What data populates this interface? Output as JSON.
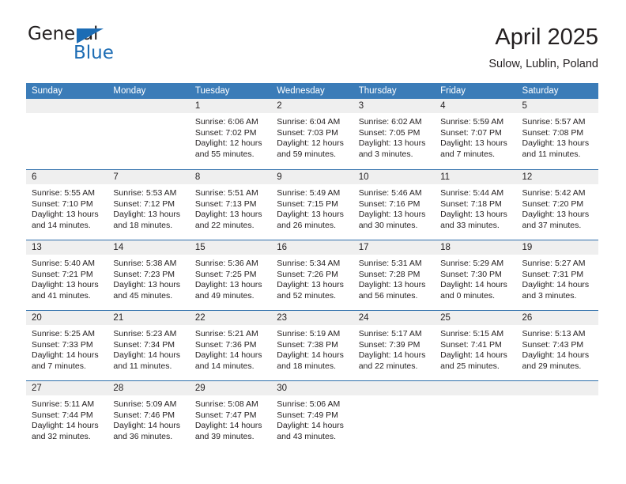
{
  "brand": {
    "name_part1": "General",
    "name_part2": "Blue",
    "colors": {
      "accent_blue": "#1c6cb4",
      "header_blue": "#3b7cb8",
      "row_rule_blue": "#2f6fab",
      "band_gray": "#efefef"
    }
  },
  "header": {
    "title": "April 2025",
    "subtitle": "Sulow, Lublin, Poland"
  },
  "weekdays": [
    "Sunday",
    "Monday",
    "Tuesday",
    "Wednesday",
    "Thursday",
    "Friday",
    "Saturday"
  ],
  "weeks": [
    [
      {
        "day": ""
      },
      {
        "day": ""
      },
      {
        "day": "1",
        "sunrise": "Sunrise: 6:06 AM",
        "sunset": "Sunset: 7:02 PM",
        "daylight": "Daylight: 12 hours and 55 minutes."
      },
      {
        "day": "2",
        "sunrise": "Sunrise: 6:04 AM",
        "sunset": "Sunset: 7:03 PM",
        "daylight": "Daylight: 12 hours and 59 minutes."
      },
      {
        "day": "3",
        "sunrise": "Sunrise: 6:02 AM",
        "sunset": "Sunset: 7:05 PM",
        "daylight": "Daylight: 13 hours and 3 minutes."
      },
      {
        "day": "4",
        "sunrise": "Sunrise: 5:59 AM",
        "sunset": "Sunset: 7:07 PM",
        "daylight": "Daylight: 13 hours and 7 minutes."
      },
      {
        "day": "5",
        "sunrise": "Sunrise: 5:57 AM",
        "sunset": "Sunset: 7:08 PM",
        "daylight": "Daylight: 13 hours and 11 minutes."
      }
    ],
    [
      {
        "day": "6",
        "sunrise": "Sunrise: 5:55 AM",
        "sunset": "Sunset: 7:10 PM",
        "daylight": "Daylight: 13 hours and 14 minutes."
      },
      {
        "day": "7",
        "sunrise": "Sunrise: 5:53 AM",
        "sunset": "Sunset: 7:12 PM",
        "daylight": "Daylight: 13 hours and 18 minutes."
      },
      {
        "day": "8",
        "sunrise": "Sunrise: 5:51 AM",
        "sunset": "Sunset: 7:13 PM",
        "daylight": "Daylight: 13 hours and 22 minutes."
      },
      {
        "day": "9",
        "sunrise": "Sunrise: 5:49 AM",
        "sunset": "Sunset: 7:15 PM",
        "daylight": "Daylight: 13 hours and 26 minutes."
      },
      {
        "day": "10",
        "sunrise": "Sunrise: 5:46 AM",
        "sunset": "Sunset: 7:16 PM",
        "daylight": "Daylight: 13 hours and 30 minutes."
      },
      {
        "day": "11",
        "sunrise": "Sunrise: 5:44 AM",
        "sunset": "Sunset: 7:18 PM",
        "daylight": "Daylight: 13 hours and 33 minutes."
      },
      {
        "day": "12",
        "sunrise": "Sunrise: 5:42 AM",
        "sunset": "Sunset: 7:20 PM",
        "daylight": "Daylight: 13 hours and 37 minutes."
      }
    ],
    [
      {
        "day": "13",
        "sunrise": "Sunrise: 5:40 AM",
        "sunset": "Sunset: 7:21 PM",
        "daylight": "Daylight: 13 hours and 41 minutes."
      },
      {
        "day": "14",
        "sunrise": "Sunrise: 5:38 AM",
        "sunset": "Sunset: 7:23 PM",
        "daylight": "Daylight: 13 hours and 45 minutes."
      },
      {
        "day": "15",
        "sunrise": "Sunrise: 5:36 AM",
        "sunset": "Sunset: 7:25 PM",
        "daylight": "Daylight: 13 hours and 49 minutes."
      },
      {
        "day": "16",
        "sunrise": "Sunrise: 5:34 AM",
        "sunset": "Sunset: 7:26 PM",
        "daylight": "Daylight: 13 hours and 52 minutes."
      },
      {
        "day": "17",
        "sunrise": "Sunrise: 5:31 AM",
        "sunset": "Sunset: 7:28 PM",
        "daylight": "Daylight: 13 hours and 56 minutes."
      },
      {
        "day": "18",
        "sunrise": "Sunrise: 5:29 AM",
        "sunset": "Sunset: 7:30 PM",
        "daylight": "Daylight: 14 hours and 0 minutes."
      },
      {
        "day": "19",
        "sunrise": "Sunrise: 5:27 AM",
        "sunset": "Sunset: 7:31 PM",
        "daylight": "Daylight: 14 hours and 3 minutes."
      }
    ],
    [
      {
        "day": "20",
        "sunrise": "Sunrise: 5:25 AM",
        "sunset": "Sunset: 7:33 PM",
        "daylight": "Daylight: 14 hours and 7 minutes."
      },
      {
        "day": "21",
        "sunrise": "Sunrise: 5:23 AM",
        "sunset": "Sunset: 7:34 PM",
        "daylight": "Daylight: 14 hours and 11 minutes."
      },
      {
        "day": "22",
        "sunrise": "Sunrise: 5:21 AM",
        "sunset": "Sunset: 7:36 PM",
        "daylight": "Daylight: 14 hours and 14 minutes."
      },
      {
        "day": "23",
        "sunrise": "Sunrise: 5:19 AM",
        "sunset": "Sunset: 7:38 PM",
        "daylight": "Daylight: 14 hours and 18 minutes."
      },
      {
        "day": "24",
        "sunrise": "Sunrise: 5:17 AM",
        "sunset": "Sunset: 7:39 PM",
        "daylight": "Daylight: 14 hours and 22 minutes."
      },
      {
        "day": "25",
        "sunrise": "Sunrise: 5:15 AM",
        "sunset": "Sunset: 7:41 PM",
        "daylight": "Daylight: 14 hours and 25 minutes."
      },
      {
        "day": "26",
        "sunrise": "Sunrise: 5:13 AM",
        "sunset": "Sunset: 7:43 PM",
        "daylight": "Daylight: 14 hours and 29 minutes."
      }
    ],
    [
      {
        "day": "27",
        "sunrise": "Sunrise: 5:11 AM",
        "sunset": "Sunset: 7:44 PM",
        "daylight": "Daylight: 14 hours and 32 minutes."
      },
      {
        "day": "28",
        "sunrise": "Sunrise: 5:09 AM",
        "sunset": "Sunset: 7:46 PM",
        "daylight": "Daylight: 14 hours and 36 minutes."
      },
      {
        "day": "29",
        "sunrise": "Sunrise: 5:08 AM",
        "sunset": "Sunset: 7:47 PM",
        "daylight": "Daylight: 14 hours and 39 minutes."
      },
      {
        "day": "30",
        "sunrise": "Sunrise: 5:06 AM",
        "sunset": "Sunset: 7:49 PM",
        "daylight": "Daylight: 14 hours and 43 minutes."
      },
      {
        "day": ""
      },
      {
        "day": ""
      },
      {
        "day": ""
      }
    ]
  ]
}
